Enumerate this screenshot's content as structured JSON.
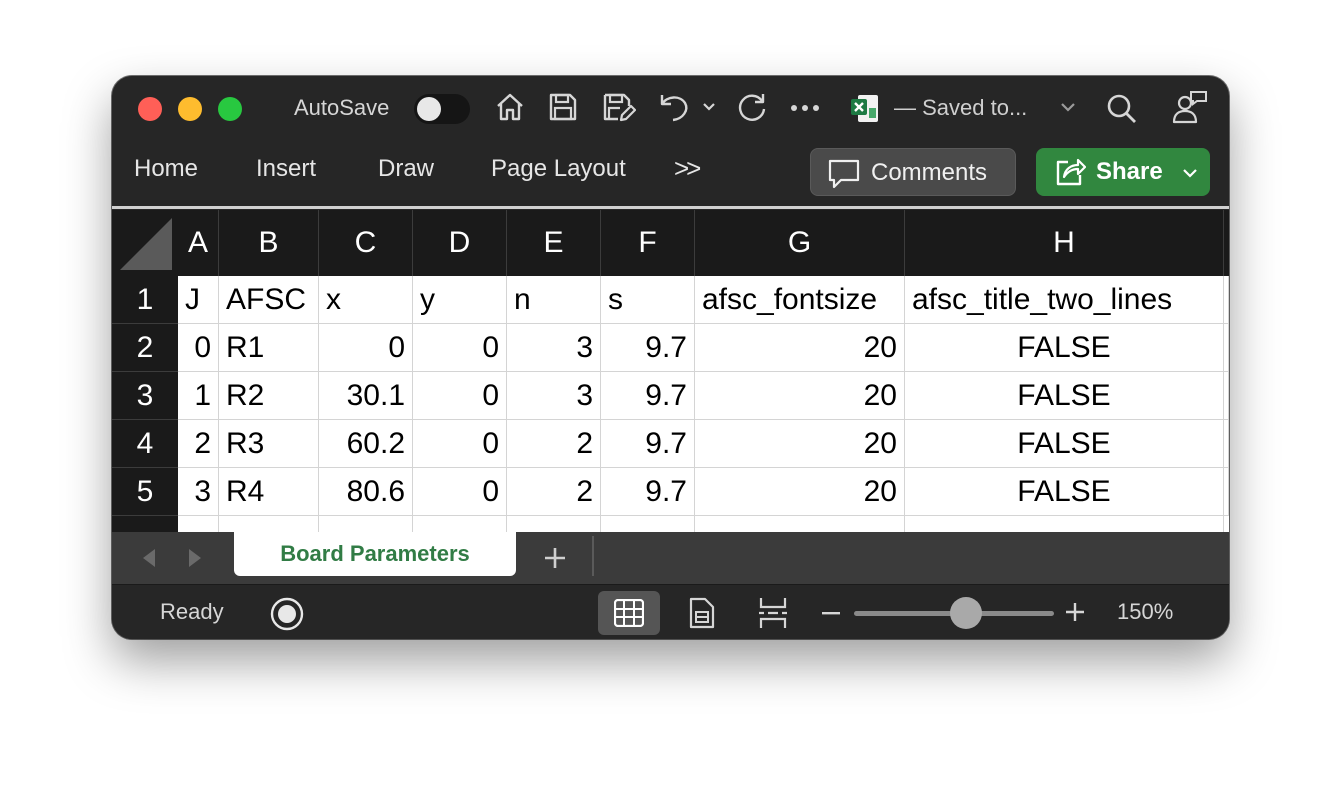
{
  "titlebar": {
    "autosave_label": "AutoSave",
    "document_status": "— Saved to...",
    "icons": [
      "home-icon",
      "save-icon",
      "save-as-icon",
      "undo-icon",
      "undo-dropdown-icon",
      "redo-icon",
      "more-icon",
      "excel-file-icon",
      "chevron-down-icon",
      "search-icon",
      "person-sharing-icon"
    ]
  },
  "ribbon": {
    "tabs": [
      "Home",
      "Insert",
      "Draw",
      "Page Layout"
    ],
    "overflow_label": ">>",
    "comments_label": "Comments",
    "share_label": "Share"
  },
  "sheet": {
    "columns": [
      "A",
      "B",
      "C",
      "D",
      "E",
      "F",
      "G",
      "H"
    ],
    "rows": [
      "1",
      "2",
      "3",
      "4",
      "5"
    ],
    "cells": [
      [
        "J",
        "AFSC",
        "x",
        "y",
        "n",
        "s",
        "afsc_fontsize",
        "afsc_title_two_lines"
      ],
      [
        "0",
        "R1",
        "0",
        "0",
        "3",
        "9.7",
        "20",
        "FALSE"
      ],
      [
        "1",
        "R2",
        "30.1",
        "0",
        "3",
        "9.7",
        "20",
        "FALSE"
      ],
      [
        "2",
        "R3",
        "60.2",
        "0",
        "2",
        "9.7",
        "20",
        "FALSE"
      ],
      [
        "3",
        "R4",
        "80.6",
        "0",
        "2",
        "9.7",
        "20",
        "FALSE"
      ]
    ]
  },
  "sheetbar": {
    "active_sheet": "Board Parameters",
    "add_sheet_label": "+"
  },
  "statusbar": {
    "status": "Ready",
    "zoom": "150%",
    "zoom_level_fraction": 0.6
  },
  "colors": {
    "window_bg": "#262626",
    "share_green": "#31873f",
    "sheet_tab_text": "#317c45",
    "close": "#ff5f57",
    "minimize": "#febc2e",
    "zoom": "#28c840"
  }
}
